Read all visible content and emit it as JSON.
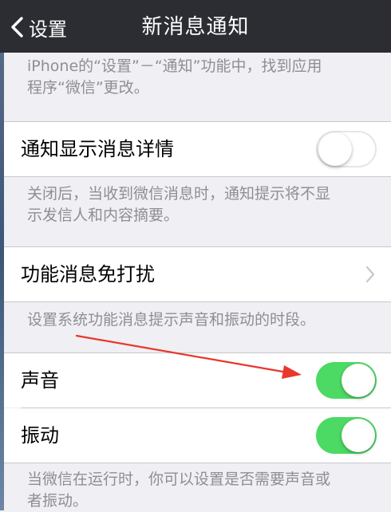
{
  "nav": {
    "back_label": "设置",
    "title": "新消息通知"
  },
  "top_footnote": {
    "line1": "iPhone的“设置”－“通知”功能中，找到应用",
    "line2": "程序“微信”更改。"
  },
  "settings": {
    "show_details": {
      "label": "通知显示消息详情",
      "enabled": false,
      "footnote_line1": "关闭后，当收到微信消息时，通知提示将不显",
      "footnote_line2": "示发信人和内容摘要。"
    },
    "do_not_disturb": {
      "label": "功能消息免打扰",
      "footnote": "设置系统功能消息提示声音和振动的时段。"
    },
    "sound": {
      "label": "声音",
      "enabled": true
    },
    "vibration": {
      "label": "振动",
      "enabled": true
    },
    "bottom_footnote_line1": "当微信在运行时，你可以设置是否需要声音或",
    "bottom_footnote_line2": "者振动。"
  },
  "colors": {
    "nav_background": "#2b2d33",
    "page_background": "#efeff4",
    "switch_on": "#4cd964",
    "annotation_arrow": "#e8372c"
  },
  "icons": {
    "back": "chevron-left-icon",
    "disclosure": "chevron-right-icon"
  }
}
